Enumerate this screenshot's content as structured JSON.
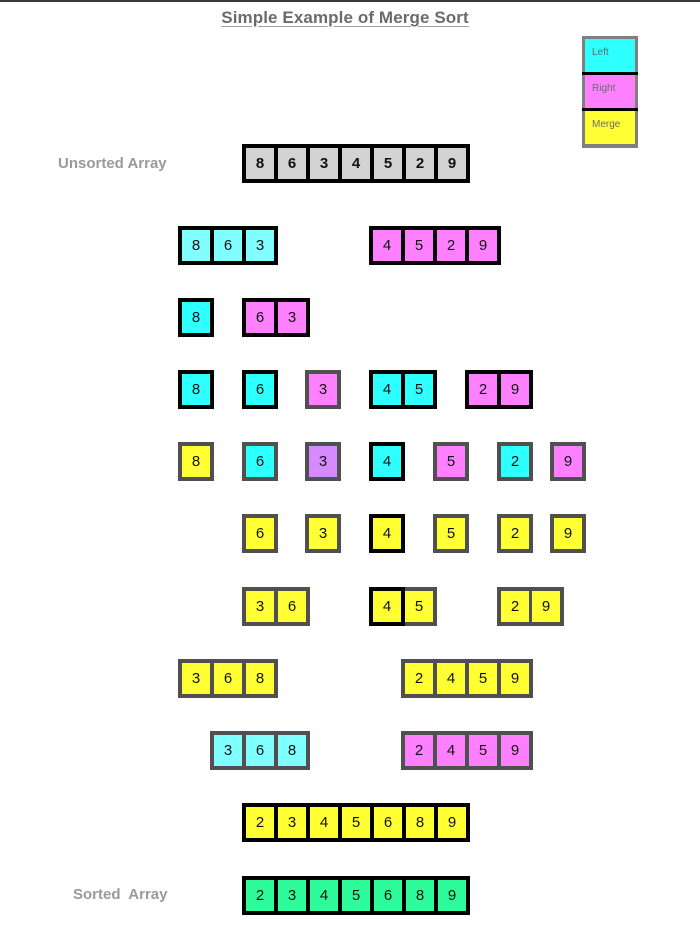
{
  "title": "Simple Example of Merge Sort",
  "legend": [
    {
      "label": "Left",
      "color": "#2effff"
    },
    {
      "label": "Right",
      "color": "#ff80ff"
    },
    {
      "label": "Merge",
      "color": "#ffff33"
    }
  ],
  "labels": {
    "unsorted": "Unsorted Array",
    "sorted": "Sorted  Array"
  },
  "colors": {
    "lgray": "#d3d3d3",
    "cyan": "#2effff",
    "lcyan": "#80ffff",
    "pink": "#ff80ff",
    "purple": "#d58aff",
    "yellow": "#ffff33",
    "green": "#2efc9a",
    "border_black": "#000000",
    "border_gray": "#505050"
  },
  "rows": [
    {
      "name": "unsorted",
      "groups": [
        {
          "values": [
            "8",
            "6",
            "3",
            "4",
            "5",
            "2",
            "9"
          ],
          "fill": "lgray",
          "border": "black",
          "bold": true
        }
      ]
    },
    {
      "name": "split-1",
      "groups": [
        {
          "values": [
            "8",
            "6",
            "3"
          ],
          "fill": "lcyan",
          "border": "black"
        },
        {
          "values": [
            "4",
            "5",
            "2",
            "9"
          ],
          "fill": "pink",
          "border": "black"
        }
      ]
    },
    {
      "name": "split-2",
      "groups": [
        {
          "values": [
            "8"
          ],
          "fill": "cyan",
          "border": "black"
        },
        {
          "values": [
            "6",
            "3"
          ],
          "fill": "pink",
          "border": "black"
        }
      ]
    },
    {
      "name": "split-3",
      "groups": [
        {
          "values": [
            "8"
          ],
          "fill": "cyan",
          "border": "black"
        },
        {
          "values": [
            "6"
          ],
          "fill": "cyan",
          "border": "black"
        },
        {
          "values": [
            "3"
          ],
          "fill": "pink",
          "border": "gray"
        },
        {
          "values": [
            "4",
            "5"
          ],
          "fill": "cyan",
          "border": "black"
        },
        {
          "values": [
            "2",
            "9"
          ],
          "fill": "pink",
          "border": "black"
        }
      ]
    },
    {
      "name": "split-4",
      "groups": [
        {
          "values": [
            "8"
          ],
          "fill": "yellow",
          "border": "gray"
        },
        {
          "values": [
            "6"
          ],
          "fill": "cyan",
          "border": "gray"
        },
        {
          "values": [
            "3"
          ],
          "fill": "purple",
          "border": "gray"
        },
        {
          "values": [
            "4"
          ],
          "fill": "cyan",
          "border": "black"
        },
        {
          "values": [
            "5"
          ],
          "fill": "pink",
          "border": "gray"
        },
        {
          "values": [
            "2"
          ],
          "fill": "cyan",
          "border": "gray"
        },
        {
          "values": [
            "9"
          ],
          "fill": "pink",
          "border": "gray"
        }
      ]
    },
    {
      "name": "merge-1",
      "groups": [
        {
          "values": [
            "6"
          ],
          "fill": "yellow",
          "border": "gray"
        },
        {
          "values": [
            "3"
          ],
          "fill": "yellow",
          "border": "gray"
        },
        {
          "values": [
            "4"
          ],
          "fill": "yellow",
          "border": "black"
        },
        {
          "values": [
            "5"
          ],
          "fill": "yellow",
          "border": "gray"
        },
        {
          "values": [
            "2"
          ],
          "fill": "yellow",
          "border": "gray"
        },
        {
          "values": [
            "9"
          ],
          "fill": "yellow",
          "border": "gray"
        }
      ]
    },
    {
      "name": "merge-2",
      "groups": [
        {
          "values": [
            "3",
            "6"
          ],
          "fill": "yellow",
          "border": "gray"
        },
        {
          "values": [
            "4",
            "5"
          ],
          "fill": "yellow",
          "border": "gray",
          "first_black": true
        },
        {
          "values": [
            "2",
            "9"
          ],
          "fill": "yellow",
          "border": "gray"
        }
      ]
    },
    {
      "name": "merge-3",
      "groups": [
        {
          "values": [
            "3",
            "6",
            "8"
          ],
          "fill": "yellow",
          "border": "gray"
        },
        {
          "values": [
            "2",
            "4",
            "5",
            "9"
          ],
          "fill": "yellow",
          "border": "gray"
        }
      ]
    },
    {
      "name": "merge-4",
      "groups": [
        {
          "values": [
            "3",
            "6",
            "8"
          ],
          "fill": "lcyan",
          "border": "gray"
        },
        {
          "values": [
            "2",
            "4",
            "5",
            "9"
          ],
          "fill": "pink",
          "border": "gray"
        }
      ]
    },
    {
      "name": "merge-5",
      "groups": [
        {
          "values": [
            "2",
            "3",
            "4",
            "5",
            "6",
            "8",
            "9"
          ],
          "fill": "yellow",
          "border": "black"
        }
      ]
    },
    {
      "name": "sorted",
      "groups": [
        {
          "values": [
            "2",
            "3",
            "4",
            "5",
            "6",
            "8",
            "9"
          ],
          "fill": "green",
          "border": "black"
        }
      ]
    }
  ]
}
